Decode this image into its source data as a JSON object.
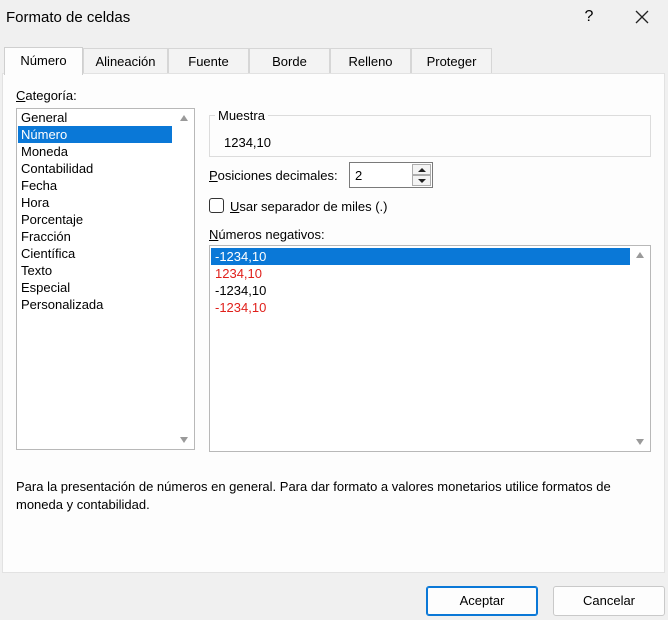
{
  "window": {
    "title": "Formato de celdas",
    "help_label": "?",
    "close_label": "✕"
  },
  "tabs": [
    {
      "label": "Número",
      "active": true
    },
    {
      "label": "Alineación",
      "active": false
    },
    {
      "label": "Fuente",
      "active": false
    },
    {
      "label": "Borde",
      "active": false
    },
    {
      "label": "Relleno",
      "active": false
    },
    {
      "label": "Proteger",
      "active": false
    }
  ],
  "category": {
    "label_first": "C",
    "label_rest": "ategoría:",
    "items": [
      "General",
      "Número",
      "Moneda",
      "Contabilidad",
      "Fecha",
      "Hora",
      "Porcentaje",
      "Fracción",
      "Científica",
      "Texto",
      "Especial",
      "Personalizada"
    ],
    "selected": "Número"
  },
  "sample": {
    "label": "Muestra",
    "value": "1234,10"
  },
  "decimals": {
    "label_first": "P",
    "label_rest": "osiciones decimales:",
    "value": "2"
  },
  "thousands": {
    "label_first": "U",
    "label_rest": "sar separador de miles (.)",
    "checked": false
  },
  "negatives": {
    "label_first": "N",
    "label_rest": "úmeros negativos:",
    "items": [
      {
        "text": "-1234,10",
        "color": "#000000",
        "selected": true
      },
      {
        "text": "1234,10",
        "color": "#e0201b",
        "selected": false
      },
      {
        "text": "-1234,10",
        "color": "#000000",
        "selected": false
      },
      {
        "text": "-1234,10",
        "color": "#e0201b",
        "selected": false
      }
    ]
  },
  "description": "Para la presentación de números en general. Para dar formato a valores monetarios utilice formatos de moneda y contabilidad.",
  "buttons": {
    "ok": "Aceptar",
    "cancel": "Cancelar"
  }
}
